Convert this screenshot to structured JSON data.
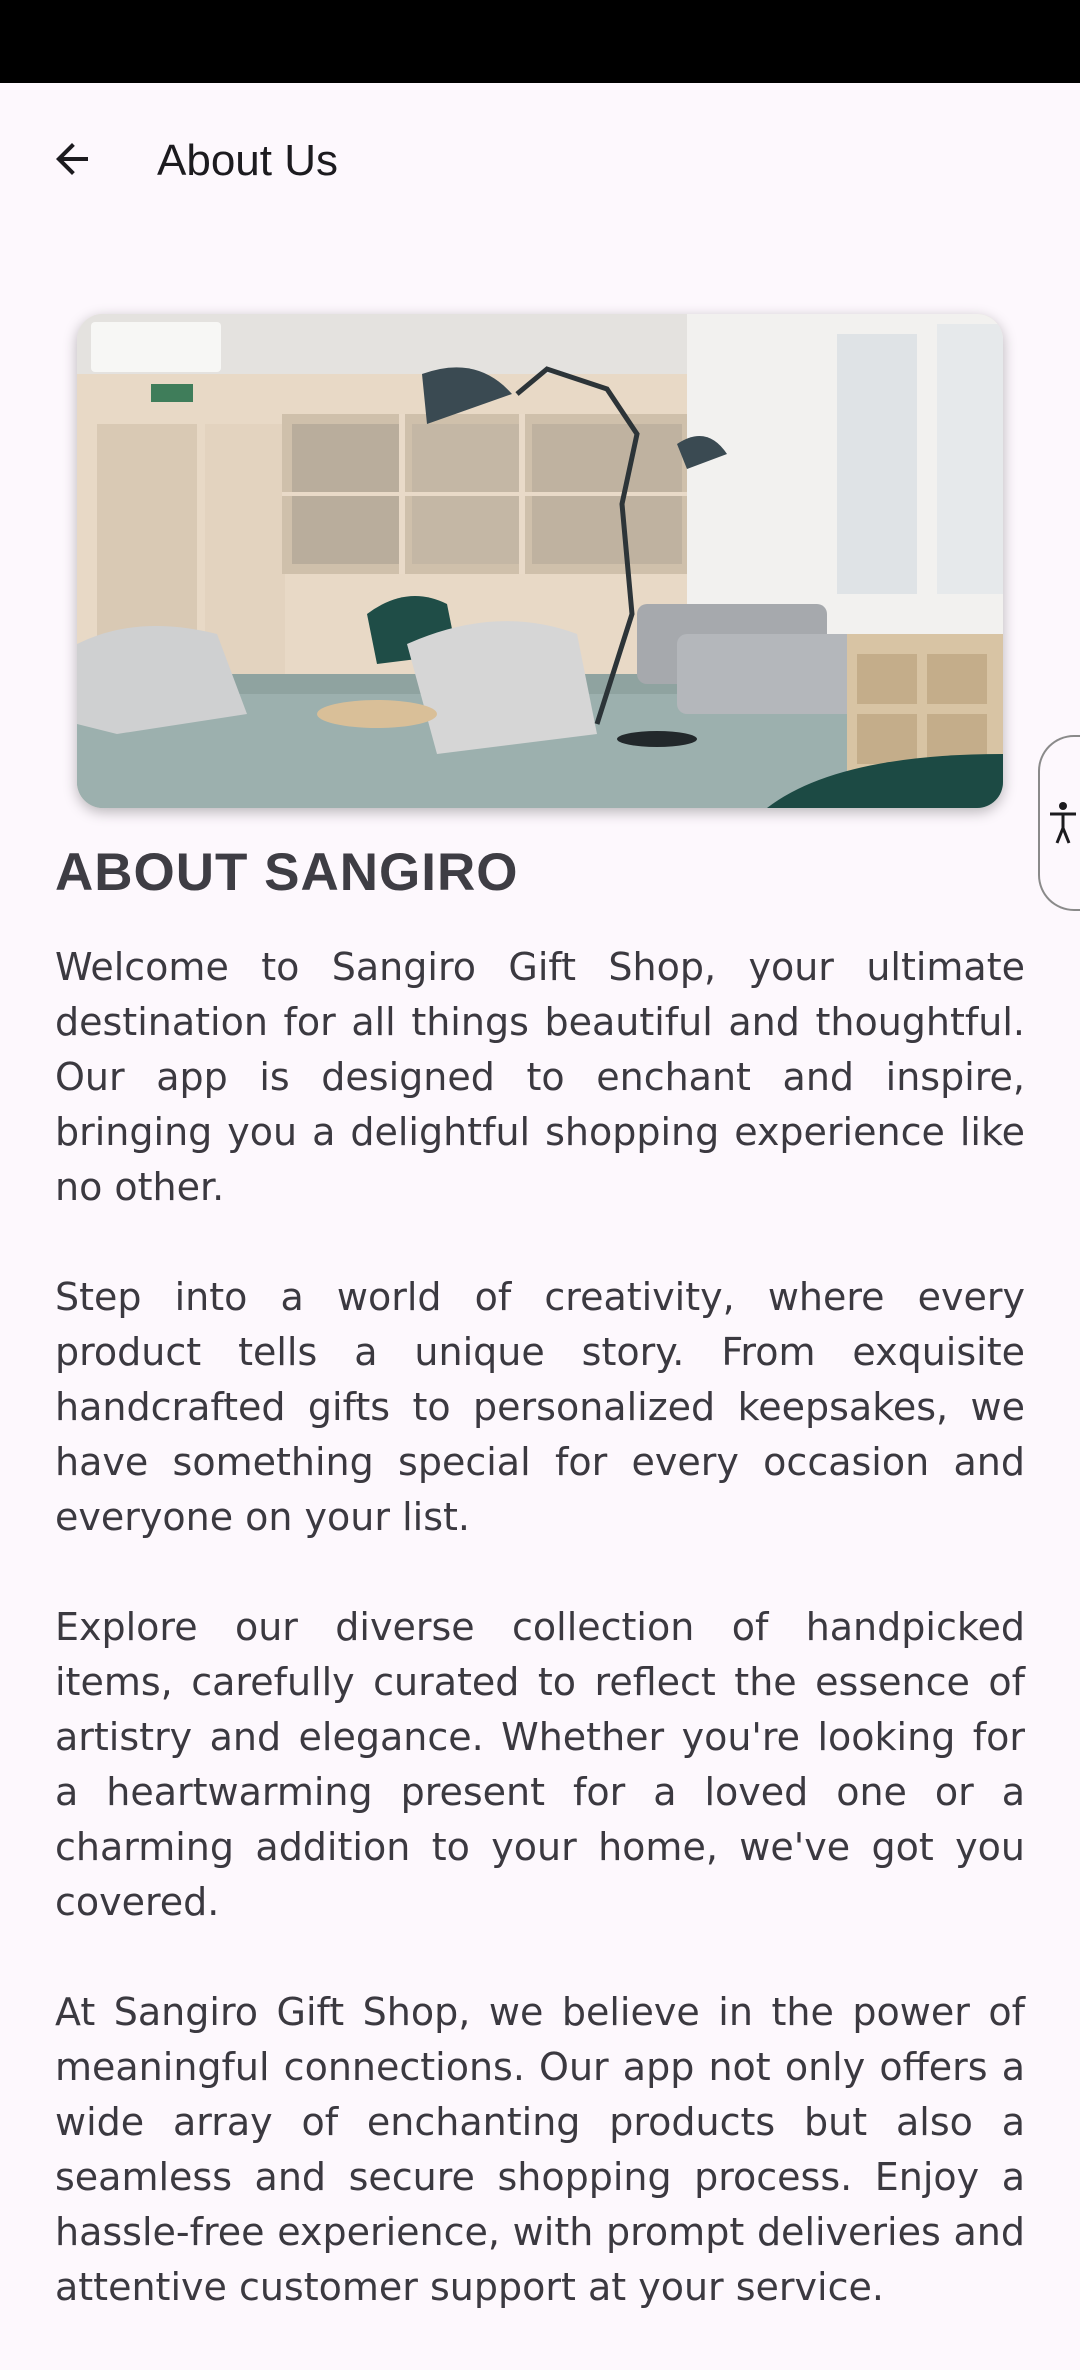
{
  "app_bar": {
    "title": "About Us"
  },
  "icons": {
    "back": "arrow-left-icon",
    "accessibility": "accessibility-person-icon"
  },
  "hero_image": {
    "description_icon": "office-lounge-photo"
  },
  "content": {
    "heading": "ABOUT SANGIRO",
    "paragraphs": [
      "Welcome to Sangiro Gift Shop, your ultimate destination for all things beautiful and thoughtful. Our app is designed to enchant and inspire, bringing you a delightful shopping experience like no other.",
      "Step into a world of creativity, where every product tells a unique story. From exquisite handcrafted gifts to personalized keepsakes, we have something special for every occasion and everyone on your list.",
      "Explore our diverse collection of handpicked items, carefully curated to reflect the essence of artistry and elegance. Whether you're looking for a heartwarming present for a loved one or a charming addition to your home, we've got you covered.",
      "At Sangiro Gift Shop, we believe in the power of meaningful connections. Our app not only offers a wide array of enchanting products but also a seamless and secure shopping process. Enjoy a hassle-free experience, with prompt deliveries and attentive customer support at your service."
    ]
  },
  "colors": {
    "background": "#fdf8fd",
    "status_bar": "#000000",
    "text": "#3b3940"
  }
}
